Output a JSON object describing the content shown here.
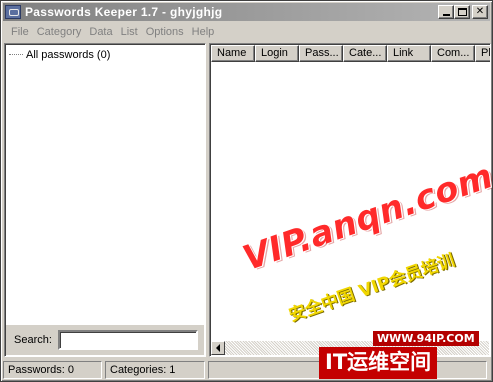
{
  "window": {
    "title": "Passwords Keeper 1.7 - ghyjghjg",
    "icon": "lock-app-icon"
  },
  "menu": {
    "items": [
      {
        "label": "File"
      },
      {
        "label": "Category"
      },
      {
        "label": "Data"
      },
      {
        "label": "List"
      },
      {
        "label": "Options"
      },
      {
        "label": "Help"
      }
    ]
  },
  "tree": {
    "root_label": "All passwords (0)"
  },
  "search": {
    "label": "Search:",
    "value": ""
  },
  "list": {
    "columns": [
      "Name",
      "Login",
      "Pass...",
      "Cate...",
      "Link",
      "Com...",
      "Pl"
    ]
  },
  "status": {
    "passwords": "Passwords: 0",
    "categories": "Categories: 1"
  },
  "watermark": {
    "vip": "VIP.anqn.com",
    "cn_line": "安全中国 VIP会员培训",
    "site": "WWW.94IP.COM",
    "brand": "IT运维空间"
  },
  "colors": {
    "title_gradient_start": "#808080",
    "title_gradient_end": "#b5b5b5",
    "face": "#d4d0c8",
    "watermark_red": "#ff2a2a"
  }
}
